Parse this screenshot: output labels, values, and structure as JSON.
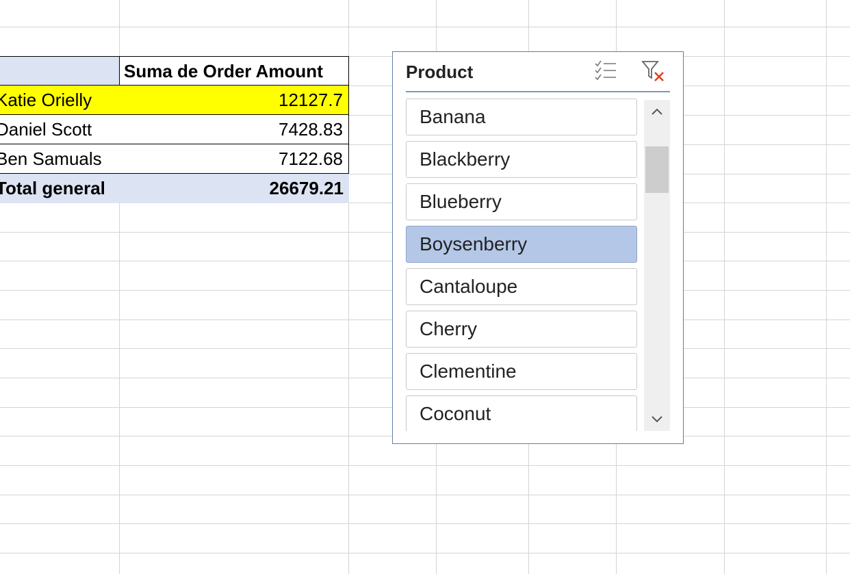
{
  "pivot": {
    "header_value": "Suma de Order Amount",
    "rows": [
      {
        "name": "Katie Orielly",
        "value": "12127.7"
      },
      {
        "name": "Daniel Scott",
        "value": "7428.83"
      },
      {
        "name": "Ben Samuals",
        "value": "7122.68"
      }
    ],
    "total_label": "Total general",
    "total_value": "26679.21",
    "highlight_color": "#ffff00",
    "header_fill": "#dce3f3"
  },
  "slicer": {
    "title": "Product",
    "multi_select_icon": "multi-select-icon",
    "clear_filter_icon": "clear-filter-icon",
    "items": [
      {
        "label": "Banana",
        "selected": false
      },
      {
        "label": "Blackberry",
        "selected": false
      },
      {
        "label": "Blueberry",
        "selected": false
      },
      {
        "label": "Boysenberry",
        "selected": true
      },
      {
        "label": "Cantaloupe",
        "selected": false
      },
      {
        "label": "Cherry",
        "selected": false
      },
      {
        "label": "Clementine",
        "selected": false
      },
      {
        "label": "Coconut",
        "selected": false
      }
    ],
    "selected_color": "#b4c7e7",
    "border_color": "#5b7fa8"
  }
}
